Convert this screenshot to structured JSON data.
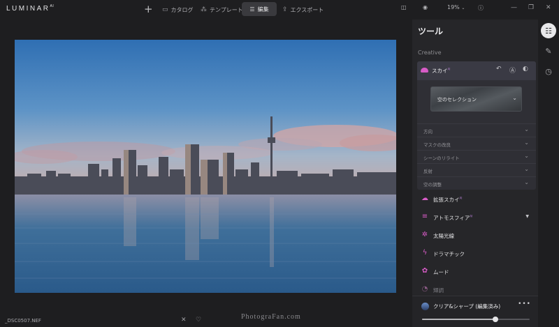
{
  "app": {
    "logo": "LUMINAR",
    "logo_sup": "AI"
  },
  "toolbar": {
    "add_label": "+",
    "catalog_label": "カタログ",
    "templates_label": "テンプレート",
    "edit_label": "編集",
    "export_label": "エクスポート",
    "zoom_label": "19%"
  },
  "image": {
    "filename": "_DSC0507.NEF",
    "watermark": "PhotograFan.com"
  },
  "panel": {
    "title": "ツール",
    "section": "Creative",
    "sky": {
      "label": "スカイ",
      "label_sup": "AI",
      "selection_label": "空のセレクション",
      "subsections": [
        "方向",
        "マスクの改良",
        "シーンのリライト",
        "反射",
        "空の調整"
      ]
    },
    "tools": [
      {
        "label": "拡張スカイ",
        "sup": "AI",
        "icon": "cloud-icon"
      },
      {
        "label": "アトモスフィア",
        "sup": "AI",
        "icon": "layers-icon"
      },
      {
        "label": "太陽光線",
        "sup": "",
        "icon": "sun-icon"
      },
      {
        "label": "ドラマチック",
        "sup": "",
        "icon": "lightning-icon"
      },
      {
        "label": "ムード",
        "sup": "",
        "icon": "mood-icon"
      },
      {
        "label": "輝調",
        "sup": "",
        "icon": "tone-icon"
      }
    ],
    "favorite": {
      "label": "クリア&シャープ (編集済み)",
      "slider_value": 0.68
    }
  },
  "colors": {
    "accent": "#d85cc7",
    "panel_bg": "#262629",
    "app_bg": "#1e1e20"
  }
}
